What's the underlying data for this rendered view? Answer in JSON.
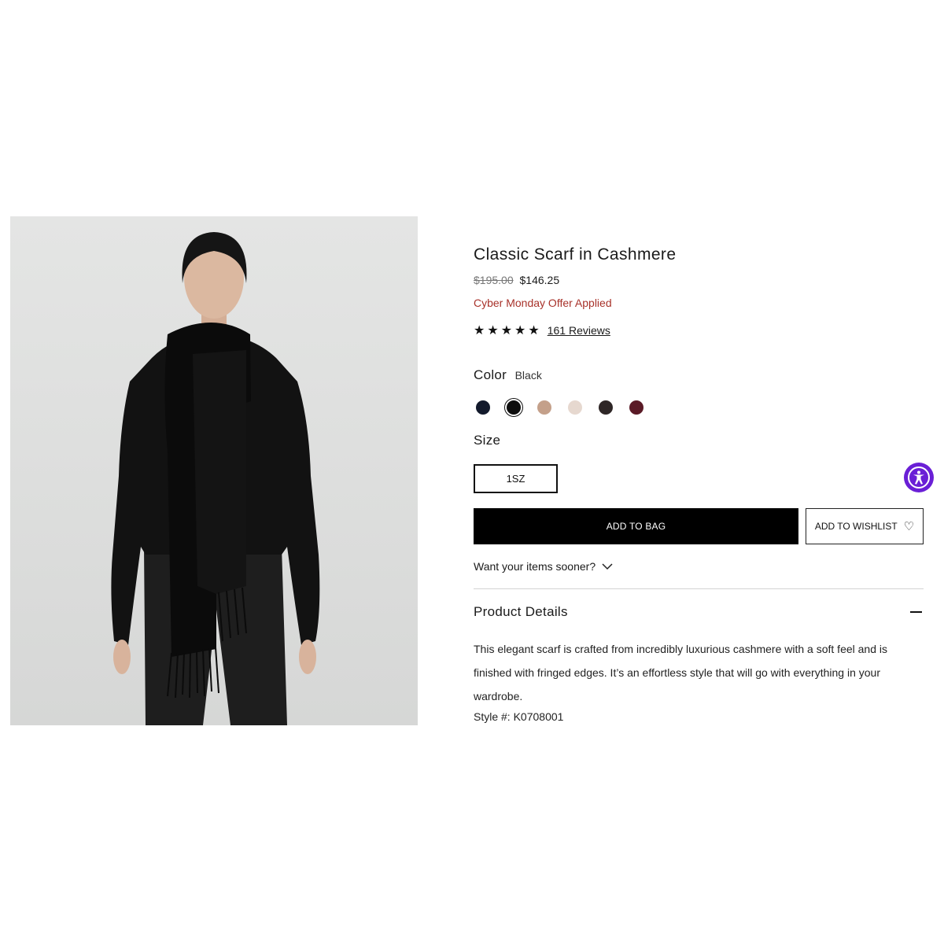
{
  "product": {
    "title": "Classic Scarf in Cashmere",
    "original_price": "$195.00",
    "sale_price": "$146.25",
    "offer_text": "Cyber Monday Offer Applied",
    "rating_stars": "★★★★★",
    "rating_value": 5,
    "reviews_label": "161 Reviews",
    "style_label": "Style #:",
    "style_number": "K0708001"
  },
  "color": {
    "label": "Color",
    "selected": "Black",
    "swatches": [
      {
        "hex": "#131a2c"
      },
      {
        "hex": "#0d0d0d",
        "selected": true
      },
      {
        "hex": "#c4a08a"
      },
      {
        "hex": "#e6d8cf"
      },
      {
        "hex": "#2e2626"
      },
      {
        "hex": "#5a1a26"
      }
    ]
  },
  "size": {
    "label": "Size",
    "option": "1SZ"
  },
  "actions": {
    "add_to_bag": "ADD TO BAG",
    "add_to_wishlist": "ADD TO WISHLIST",
    "wishlist_icon": "heart-icon",
    "sooner": "Want your items sooner?"
  },
  "details": {
    "title": "Product Details",
    "description": "This elegant scarf is crafted from incredibly luxurious cashmere with a soft feel and is finished with fringed edges. It’s an effortless style that will go with everything in your wardrobe."
  },
  "accessibility": {
    "icon": "accessibility-icon",
    "color": "#6a1fd6"
  }
}
